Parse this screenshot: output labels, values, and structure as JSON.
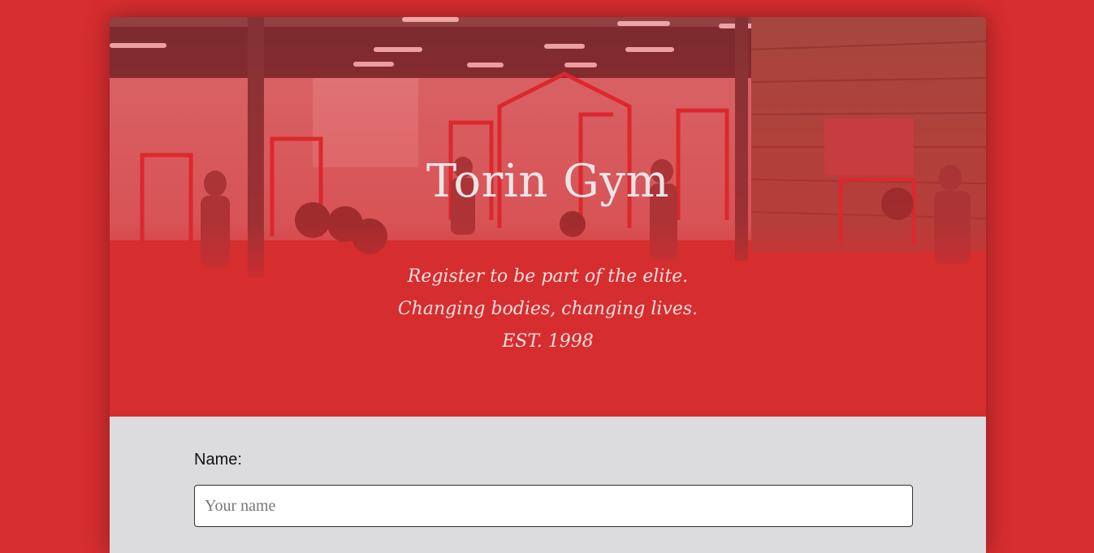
{
  "hero": {
    "title": "Torin Gym",
    "tagline": [
      "Register to be part of the elite.",
      "Changing bodies, changing lives.",
      "EST. 1998"
    ]
  },
  "form": {
    "name_label": "Name:",
    "name_placeholder": "Your name",
    "name_value": ""
  },
  "colors": {
    "background": "#d62d2f",
    "form_background": "#dcdcde",
    "title_text": "#e8e4e6"
  }
}
